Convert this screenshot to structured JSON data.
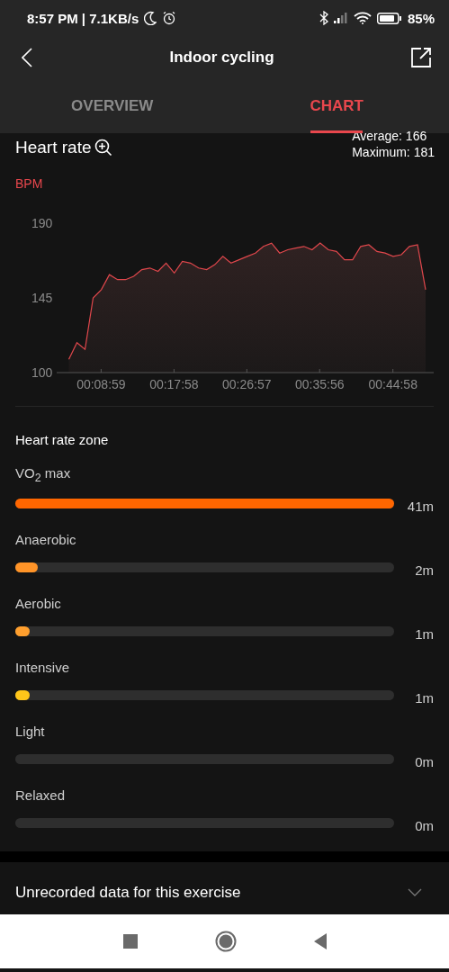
{
  "status_bar": {
    "time": "8:57 PM | 7.1KB/s",
    "battery": "85%"
  },
  "header": {
    "title": "Indoor cycling"
  },
  "tabs": [
    {
      "label": "OVERVIEW",
      "selected": false
    },
    {
      "label": "CHART",
      "selected": true
    }
  ],
  "heart_rate": {
    "title": "Heart rate",
    "average": "Average: 166",
    "maximum": "Maximum: 181",
    "unit": "BPM",
    "chart_data": {
      "type": "area",
      "x": [
        5,
        6,
        7,
        8,
        9,
        10,
        11,
        12,
        13,
        14,
        15,
        16,
        17,
        18,
        19,
        20,
        21,
        22,
        23,
        24,
        25,
        26,
        27,
        28,
        29,
        30,
        31,
        32,
        33,
        34,
        35,
        36,
        37,
        38,
        39,
        40,
        41,
        42,
        43,
        44,
        45,
        46,
        47,
        48,
        49
      ],
      "series": [
        {
          "color": "#e0474c",
          "values": [
            108,
            118,
            114,
            145,
            150,
            159,
            156,
            156,
            158,
            162,
            163,
            161,
            166,
            160,
            167,
            166,
            163,
            162,
            165,
            170,
            166,
            168,
            170,
            172,
            176,
            178,
            172,
            174,
            175,
            176,
            174,
            178,
            174,
            173,
            168,
            168,
            176,
            177,
            173,
            172,
            170,
            171,
            176,
            177,
            150
          ]
        }
      ],
      "xlim": [
        3.5,
        50
      ],
      "ylim": [
        100,
        190
      ],
      "xticks": [
        {
          "value": 8.98,
          "label": "00:08:59"
        },
        {
          "value": 17.97,
          "label": "00:17:58"
        },
        {
          "value": 26.95,
          "label": "00:26:57"
        },
        {
          "value": 35.93,
          "label": "00:35:56"
        },
        {
          "value": 44.97,
          "label": "00:44:58"
        }
      ],
      "yticks": [
        100,
        145,
        190
      ]
    }
  },
  "zones": {
    "title": "Heart rate zone",
    "items": [
      {
        "label": "VO$_{2}$ max",
        "level": 1.0,
        "color": "#ff6600",
        "duration": "41m"
      },
      {
        "label": "Anaerobic",
        "level": 0.06,
        "color": "#ff9428",
        "duration": "2m"
      },
      {
        "label": "Aerobic",
        "level": 0.035,
        "color": "#ff9f2e",
        "duration": "1m"
      },
      {
        "label": "Intensive",
        "level": 0.035,
        "color": "#ffc61a",
        "duration": "1m"
      },
      {
        "label": "Light",
        "duration": "0m"
      },
      {
        "label": "Relaxed",
        "duration": "0m"
      }
    ]
  },
  "unrecorded": {
    "label": "Unrecorded data for this exercise",
    "expanded": false
  }
}
